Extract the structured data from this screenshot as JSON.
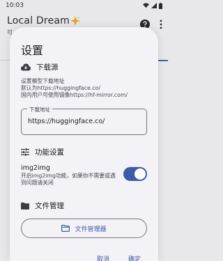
{
  "status_bar": {
    "time": "10:03"
  },
  "app": {
    "title": "Local Dream",
    "subtitle_fragment": "可"
  },
  "dialog": {
    "title": "设置",
    "download_source": {
      "heading": "下载源",
      "description_lines": [
        "设置模型下载地址",
        "默认为https://huggingface.co/",
        "国内用户可使用镜像https://hf-mirror.com/"
      ],
      "field_label": "下载地址",
      "field_value": "https://huggingface.co/"
    },
    "features": {
      "heading": "功能设置",
      "img2img_label": "img2img",
      "img2img_description": "开启img2img功能，如果你不需要或遇到问题请关闭",
      "img2img_enabled": true
    },
    "files": {
      "heading": "文件管理",
      "button_label": "文件管理器"
    },
    "actions": {
      "cancel": "取消",
      "ok": "确定"
    }
  },
  "colors": {
    "accent": "#3e5ba8",
    "dialog_bg": "#f3f2f7",
    "backdrop": "#e8e8ea"
  }
}
